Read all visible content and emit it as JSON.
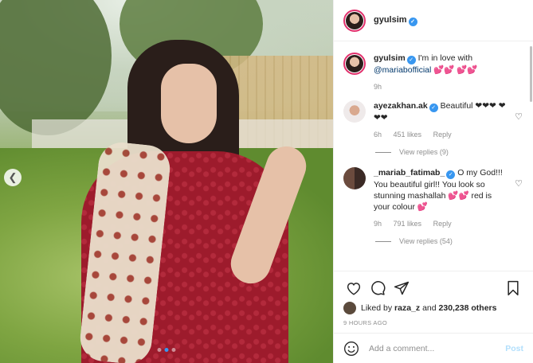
{
  "post": {
    "author": "gyulsim",
    "caption_text": "I'm in love with",
    "caption_mention": "@mariabofficial",
    "caption_emoji": "💕💕 💕💕",
    "caption_time": "9h",
    "likes_by": "raza_z",
    "likes_others": "230,238 others",
    "likes_prefix": "Liked by",
    "likes_and": "and",
    "time_ago": "9 HOURS AGO",
    "carousel_dots": 3,
    "active_dot": 2
  },
  "comments": [
    {
      "user": "ayezakhan.ak",
      "text": "Beautiful ❤❤❤ ❤❤❤",
      "time": "6h",
      "likes": "451 likes",
      "reply": "Reply",
      "view_replies": "View replies (9)"
    },
    {
      "user": "_mariab_fatimab_",
      "text": "O my God!!! You beautiful girl!! You look so stunning mashallah 💕💕 red is your colour 💕",
      "time": "9h",
      "likes": "791 likes",
      "reply": "Reply",
      "view_replies": "View replies (54)"
    }
  ],
  "add_comment": {
    "placeholder": "Add a comment...",
    "post_label": "Post"
  },
  "icons": {
    "like": "heart-icon",
    "comment": "comment-icon",
    "share": "share-icon",
    "save": "bookmark-icon",
    "emoji": "emoji-icon",
    "prev": "chevron-left-icon"
  },
  "colors": {
    "verified": "#3897f0",
    "post_disabled": "#b2dffc",
    "story_ring": "#e1306c"
  }
}
